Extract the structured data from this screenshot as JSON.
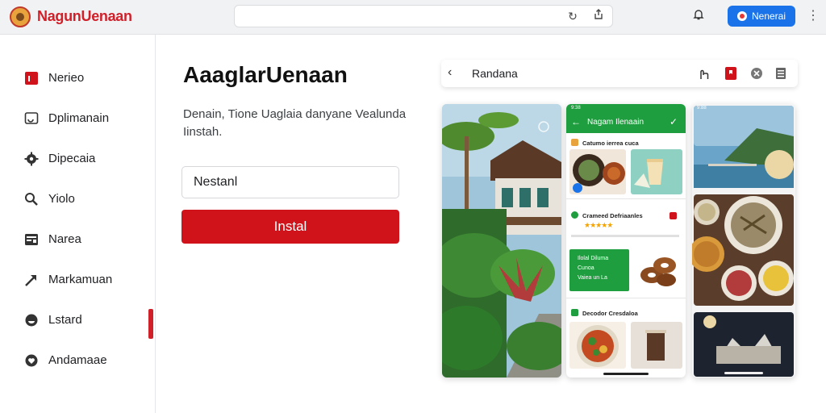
{
  "brand": {
    "name": "NagunUenaan"
  },
  "topbar": {
    "button_label": "Nenerai"
  },
  "sidebar": {
    "items": [
      {
        "label": "Nerieo",
        "icon": "app-square-icon"
      },
      {
        "label": "Dplimanain",
        "icon": "message-icon"
      },
      {
        "label": "Dipecaia",
        "icon": "settings-icon"
      },
      {
        "label": "Yiolo",
        "icon": "search-icon"
      },
      {
        "label": "Narea",
        "icon": "card-icon"
      },
      {
        "label": "Markamuan",
        "icon": "arrow-icon"
      },
      {
        "label": "Lstard",
        "icon": "badge-icon"
      },
      {
        "label": "Andamaae",
        "icon": "heart-icon"
      }
    ],
    "selected_index": 6
  },
  "main": {
    "title": "AaaglarUenaan",
    "description": "Denain, Tione Uaglaia danyane Vealunda Iinstah.",
    "input_value": "Nestanl",
    "install_label": "Instal"
  },
  "preview": {
    "toolbar_title": "Randana",
    "phone2": {
      "header_title": "Nagam Ilenaain",
      "rows": [
        {
          "title": "Catumo ierrea cuca"
        },
        {
          "title": "Crameed Defriaanles"
        },
        {
          "title": "Decodor Cresdaloa"
        }
      ],
      "promo_lines": [
        "Ilolal Diluma",
        "Cunoa",
        "Vaiea un La"
      ],
      "rating_stars": "★★★★★",
      "time": "9:38"
    },
    "phone3": {
      "time": "9:88"
    }
  },
  "colors": {
    "brand_red": "#d0121b",
    "accent_blue": "#1a73e8",
    "app_green": "#1e9e3e"
  }
}
